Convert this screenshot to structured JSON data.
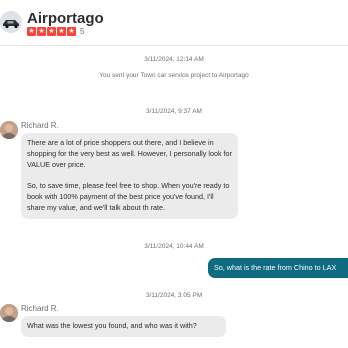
{
  "header": {
    "business_name": "Airportago",
    "rating_stars": 5,
    "review_count": "5"
  },
  "thread": {
    "ts1": "3/11/2024, 12:14 AM",
    "system_note": "You sent your Town car service project to Airportago",
    "ts2": "3/11/2024, 9:37 AM",
    "msg1_sender": "Richard R.",
    "msg1_p1": "There are a lot of price shoppers out there, and I believe in shopping for the very best as well. However, I personally look for VALUE over price.",
    "msg1_p2": "So, to save time, please feel free to shop.  When you're ready to book with 100% payment of the best price you've found, I'll share my value, and we'll talk about th rate.",
    "ts3": "3/11/2024, 10:44 AM",
    "msg2_text": "So, what is the rate from Chino to LAX",
    "ts4": "3/11/2024, 3:05 PM",
    "msg3_sender": "Richard R.",
    "msg3_text": "What was the lowest you found, and who was it with?"
  },
  "colors": {
    "star_red": "#fb433c",
    "outgoing_bubble": "#0f6c80",
    "incoming_bubble": "#ebebeb"
  }
}
